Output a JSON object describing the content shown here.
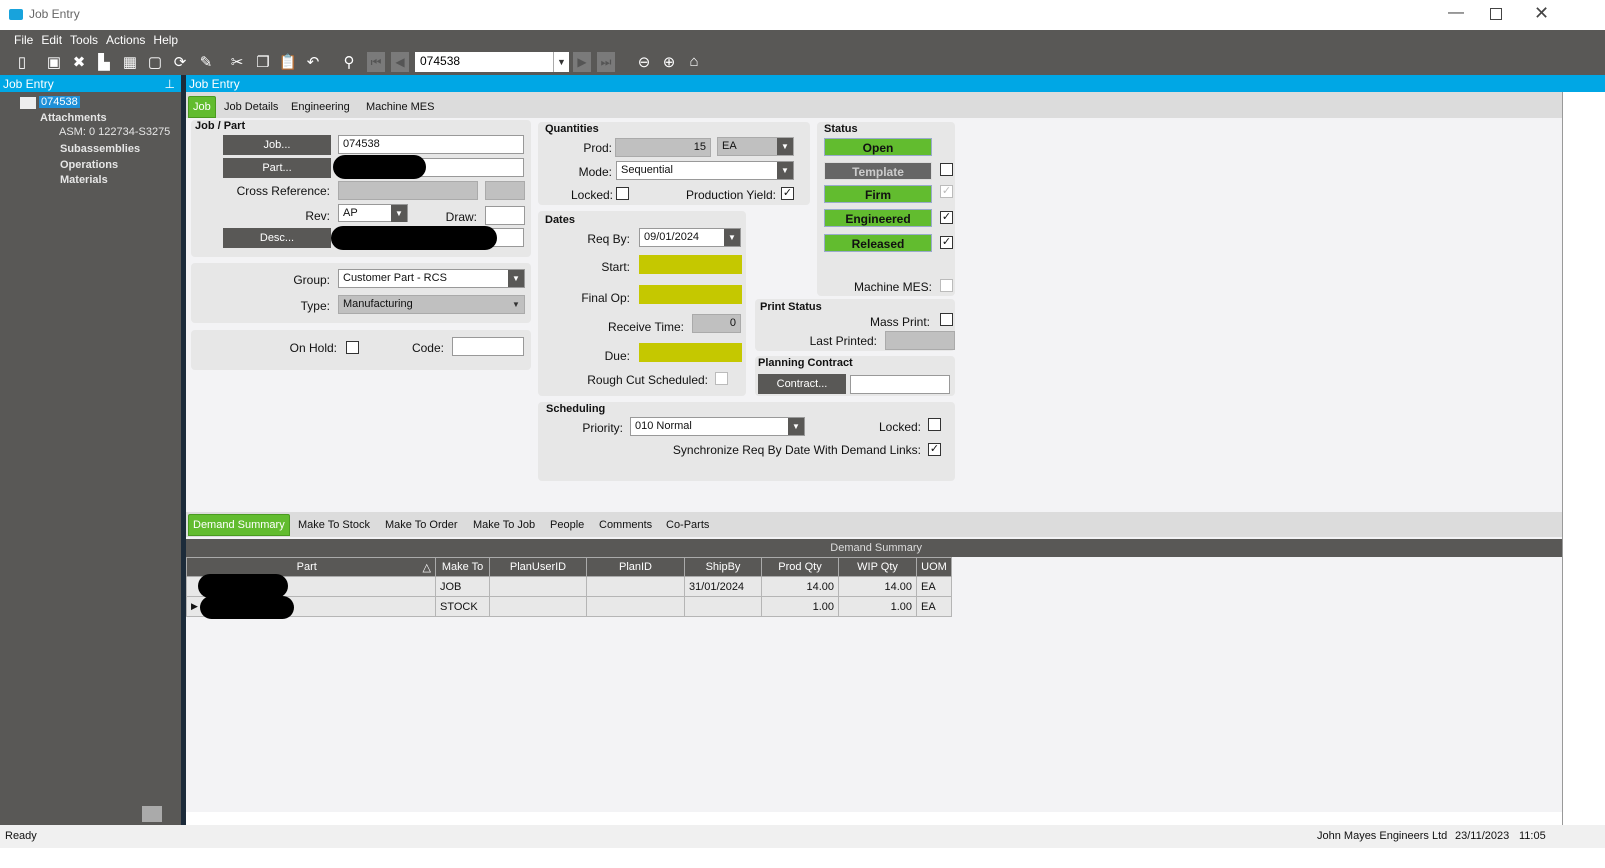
{
  "window": {
    "title": "Job Entry"
  },
  "menu": [
    "File",
    "Edit",
    "Tools",
    "Actions",
    "Help"
  ],
  "toolbar": {
    "job_number": "074538"
  },
  "left_panel": {
    "title": "Job Entry",
    "tree": {
      "root": "074538",
      "attachments": "Attachments",
      "assembly": "ASM: 0 122734-S3275",
      "subassemblies": "Subassemblies",
      "operations": "Operations",
      "materials": "Materials"
    }
  },
  "main": {
    "title": "Job Entry",
    "tabs": [
      "Job",
      "Job Details",
      "Engineering",
      "Machine MES"
    ],
    "job_part": {
      "title": "Job / Part",
      "job_btn": "Job...",
      "job_value": "074538",
      "part_btn": "Part...",
      "cross_ref": "Cross Reference:",
      "rev_label": "Rev:",
      "rev_value": "AP",
      "draw_label": "Draw:",
      "desc_btn": "Desc...",
      "group_label": "Group:",
      "group_value": "Customer Part - RCS",
      "type_label": "Type:",
      "type_value": "Manufacturing",
      "on_hold": "On Hold:",
      "code": "Code:"
    },
    "quantities": {
      "title": "Quantities",
      "prod_label": "Prod:",
      "prod_value": "15",
      "uom": "EA",
      "mode_label": "Mode:",
      "mode_value": "Sequential",
      "locked_label": "Locked:",
      "yield_label": "Production Yield:"
    },
    "dates": {
      "title": "Dates",
      "req_by_label": "Req By:",
      "req_by_value": "09/01/2024",
      "start_label": "Start:",
      "final_op_label": "Final Op:",
      "receive_label": "Receive Time:",
      "receive_value": "0",
      "due_label": "Due:",
      "rough_label": "Rough Cut Scheduled:"
    },
    "scheduling": {
      "title": "Scheduling",
      "priority_label": "Priority:",
      "priority_value": "010 Normal",
      "locked_label": "Locked:",
      "sync_label": "Synchronize Req By Date With Demand Links:"
    },
    "status": {
      "title": "Status",
      "open": "Open",
      "template": "Template",
      "firm": "Firm",
      "engineered": "Engineered",
      "released": "Released",
      "machine_mes": "Machine MES:"
    },
    "print_status": {
      "title": "Print Status",
      "mass_print": "Mass Print:",
      "last_printed": "Last Printed:"
    },
    "planning": {
      "title": "Planning Contract",
      "contract_btn": "Contract..."
    }
  },
  "bottom": {
    "tabs": [
      "Demand Summary",
      "Make To Stock",
      "Make To Order",
      "Make To Job",
      "People",
      "Comments",
      "Co-Parts"
    ],
    "grid_title": "Demand Summary",
    "columns": [
      "Part",
      "Make To",
      "PlanUserID",
      "PlanID",
      "ShipBy",
      "Prod Qty",
      "WIP Qty",
      "UOM"
    ],
    "rows": [
      [
        "",
        "JOB",
        "",
        "",
        "31/01/2024",
        "14.00",
        "14.00",
        "EA"
      ],
      [
        "",
        "STOCK",
        "",
        "",
        "",
        "1.00",
        "1.00",
        "EA"
      ]
    ]
  },
  "statusbar": {
    "left": "Ready",
    "company": "John Mayes Engineers Ltd",
    "date": "23/11/2023",
    "time": "11:05"
  },
  "colors": {
    "accent": "#00a7e5",
    "green": "#62bc2f",
    "dark": "#595856",
    "highlight": "#c5c800"
  }
}
